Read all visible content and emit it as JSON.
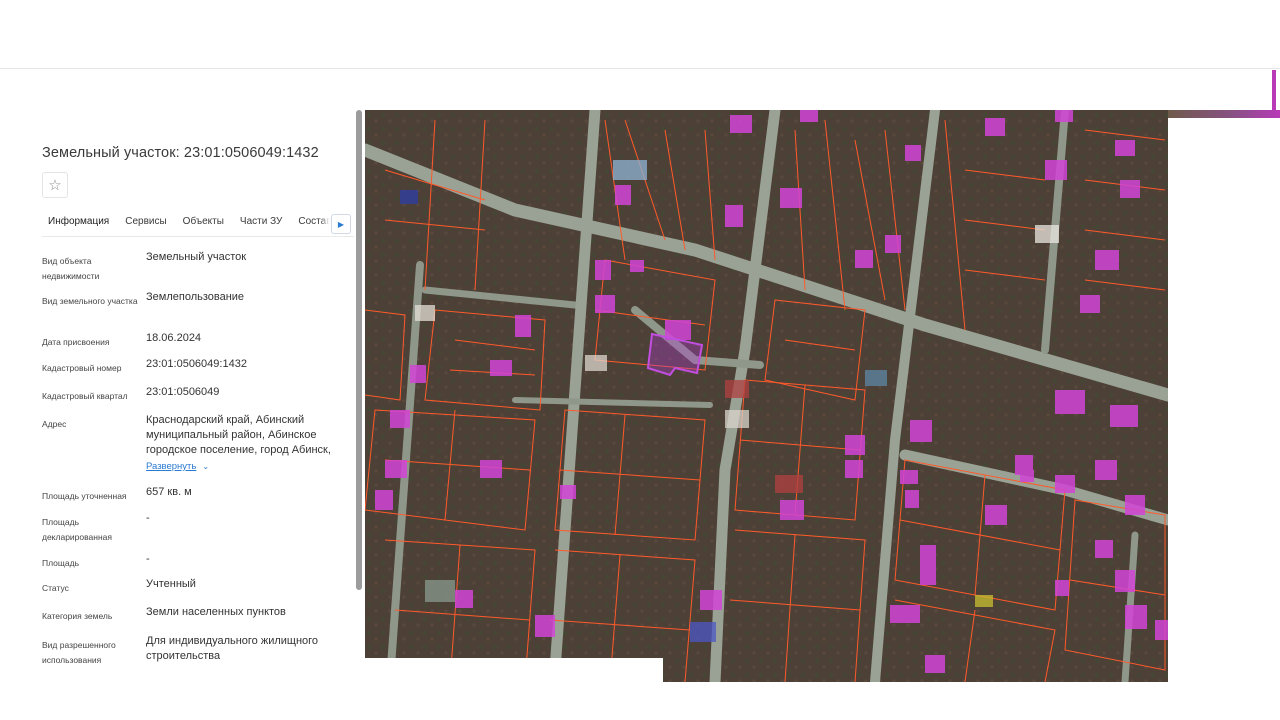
{
  "title": "Земельный участок: 23:01:0506049:1432",
  "tabs": [
    {
      "label": "Информация",
      "active": true
    },
    {
      "label": "Сервисы",
      "active": false
    },
    {
      "label": "Объекты",
      "active": false
    },
    {
      "label": "Части ЗУ",
      "active": false
    },
    {
      "label": "Состав ЗУ",
      "active": false
    }
  ],
  "icons": {
    "favorite": "star-outline-icon",
    "tabs_next": "triangle-right-icon",
    "expand_chevron": "chevron-down-icon"
  },
  "properties": [
    {
      "label": "Вид объекта недвижимости",
      "value": "Земельный участок"
    },
    {
      "label": "Вид земельного участка",
      "value": "Землепользование"
    },
    {
      "label": "Дата присвоения",
      "value": "18.06.2024"
    },
    {
      "label": "Кадастровый номер",
      "value": "23:01:0506049:1432"
    },
    {
      "label": "Кадастровый квартал",
      "value": "23:01:0506049"
    },
    {
      "label": "Адрес",
      "value": "Краснодарский край, Абинский муниципальный район, Абинское городское поселение, город Абинск,"
    },
    {
      "label": "Площадь уточненная",
      "value": "657 кв. м"
    },
    {
      "label": "Площадь декларированная",
      "value": "-"
    },
    {
      "label": "Площадь",
      "value": "-"
    },
    {
      "label": "Статус",
      "value": "Учтенный"
    },
    {
      "label": "Категория земель",
      "value": "Земли населенных пунктов"
    },
    {
      "label": "Вид разрешенного использования",
      "value": "Для индивидуального жилищного строительства"
    }
  ],
  "address_expand_label": "Развернуть",
  "colors": {
    "accent": "#2b7bd1",
    "parcel_border": "#ff5a2a",
    "building_highlight": "#d244d6",
    "selected_parcel": "#b13bd0",
    "ground": "#4a3d33",
    "road": "#8e9888"
  }
}
